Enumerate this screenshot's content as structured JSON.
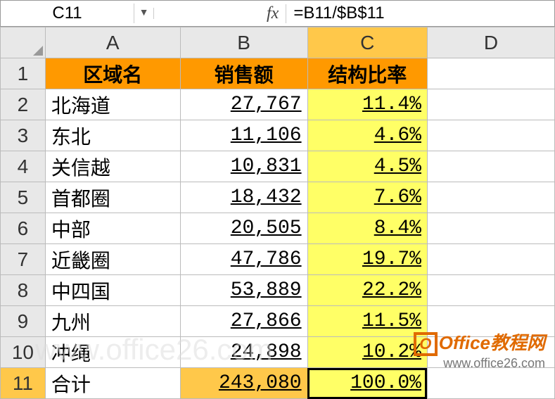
{
  "formula_bar": {
    "name_box": "C11",
    "fx_label": "fx",
    "formula": "=B11/$B$11"
  },
  "column_headers": [
    "A",
    "B",
    "C",
    "D"
  ],
  "row_headers": [
    "1",
    "2",
    "3",
    "4",
    "5",
    "6",
    "7",
    "8",
    "9",
    "10",
    "11"
  ],
  "active_col": "C",
  "active_row": "11",
  "header_row": {
    "a": "区域名",
    "b": "销售额",
    "c": "结构比率"
  },
  "rows": [
    {
      "name": "北海道",
      "sales": "27,767",
      "ratio": "11.4%"
    },
    {
      "name": "东北",
      "sales": "11,106",
      "ratio": "4.6%"
    },
    {
      "name": "关信越",
      "sales": "10,831",
      "ratio": "4.5%"
    },
    {
      "name": "首都圈",
      "sales": "18,432",
      "ratio": "7.6%"
    },
    {
      "name": "中部",
      "sales": "20,505",
      "ratio": "8.4%"
    },
    {
      "name": "近畿圈",
      "sales": "47,786",
      "ratio": "19.7%"
    },
    {
      "name": "中四国",
      "sales": "53,889",
      "ratio": "22.2%"
    },
    {
      "name": "九州",
      "sales": "27,866",
      "ratio": "11.5%"
    },
    {
      "name": "冲绳",
      "sales": "24,898",
      "ratio": "10.2%"
    }
  ],
  "total_row": {
    "name": "合计",
    "sales": "243,080",
    "ratio": "100.0%"
  },
  "watermark": "www.office26.com",
  "logo": {
    "text": "Office教程网",
    "url": "www.office26.com",
    "o": "O"
  }
}
